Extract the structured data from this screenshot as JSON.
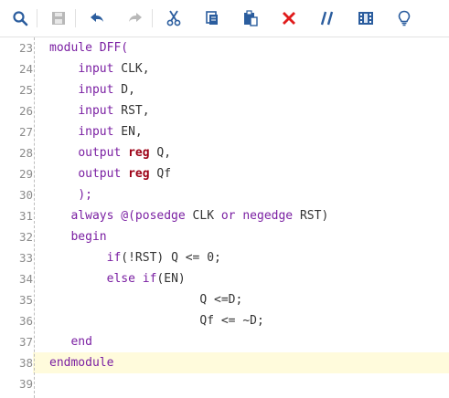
{
  "toolbar": {
    "buttons": [
      {
        "name": "search-icon",
        "enabled": true
      },
      {
        "name": "save-icon",
        "enabled": false
      },
      {
        "name": "undo-icon",
        "enabled": true
      },
      {
        "name": "redo-icon",
        "enabled": false
      },
      {
        "name": "cut-icon",
        "enabled": true
      },
      {
        "name": "copy-icon",
        "enabled": true
      },
      {
        "name": "paste-icon",
        "enabled": true
      },
      {
        "name": "delete-icon",
        "enabled": true
      },
      {
        "name": "comment-toggle-icon",
        "enabled": true
      },
      {
        "name": "template-icon",
        "enabled": true
      },
      {
        "name": "lightbulb-icon",
        "enabled": true
      }
    ],
    "colors": {
      "icon": "#2b5d9e",
      "disabled": "#b8b8b8",
      "delete": "#e01b1b"
    }
  },
  "editor": {
    "active_line": 38,
    "lines": [
      {
        "num": "23",
        "indent": "",
        "parts": [
          {
            "t": "module DFF(",
            "c": "kw"
          }
        ]
      },
      {
        "num": "24",
        "indent": "    ",
        "parts": [
          {
            "t": "input",
            "c": "kw"
          },
          {
            "t": " CLK,",
            "c": ""
          }
        ]
      },
      {
        "num": "25",
        "indent": "    ",
        "parts": [
          {
            "t": "input",
            "c": "kw"
          },
          {
            "t": " D,",
            "c": ""
          }
        ]
      },
      {
        "num": "26",
        "indent": "    ",
        "parts": [
          {
            "t": "input",
            "c": "kw"
          },
          {
            "t": " RST,",
            "c": ""
          }
        ]
      },
      {
        "num": "27",
        "indent": "    ",
        "parts": [
          {
            "t": "input",
            "c": "kw"
          },
          {
            "t": " EN,",
            "c": ""
          }
        ]
      },
      {
        "num": "28",
        "indent": "    ",
        "parts": [
          {
            "t": "output ",
            "c": "kw"
          },
          {
            "t": "reg",
            "c": "bold"
          },
          {
            "t": " Q,",
            "c": ""
          }
        ]
      },
      {
        "num": "29",
        "indent": "    ",
        "parts": [
          {
            "t": "output ",
            "c": "kw"
          },
          {
            "t": "reg",
            "c": "bold"
          },
          {
            "t": " Qf",
            "c": ""
          }
        ]
      },
      {
        "num": "30",
        "indent": "    ",
        "parts": [
          {
            "t": ");",
            "c": "kw"
          }
        ]
      },
      {
        "num": "31",
        "indent": "   ",
        "parts": [
          {
            "t": "always @(posedge",
            "c": "kw"
          },
          {
            "t": " CLK ",
            "c": ""
          },
          {
            "t": "or negedge",
            "c": "kw"
          },
          {
            "t": " RST)",
            "c": ""
          }
        ]
      },
      {
        "num": "32",
        "indent": "   ",
        "parts": [
          {
            "t": "begin",
            "c": "kw"
          }
        ]
      },
      {
        "num": "33",
        "indent": "        ",
        "parts": [
          {
            "t": "if",
            "c": "kw"
          },
          {
            "t": "(!RST) Q <= 0;",
            "c": ""
          }
        ]
      },
      {
        "num": "34",
        "indent": "        ",
        "parts": [
          {
            "t": "else if",
            "c": "kw"
          },
          {
            "t": "(EN)",
            "c": ""
          }
        ]
      },
      {
        "num": "35",
        "indent": "                     ",
        "parts": [
          {
            "t": "Q <=D;",
            "c": ""
          }
        ]
      },
      {
        "num": "36",
        "indent": "                     ",
        "parts": [
          {
            "t": "Qf <= ~D;",
            "c": ""
          }
        ]
      },
      {
        "num": "37",
        "indent": "   ",
        "parts": [
          {
            "t": "end",
            "c": "kw"
          }
        ]
      },
      {
        "num": "38",
        "indent": "",
        "parts": [
          {
            "t": "endmodule",
            "c": "kw"
          }
        ]
      },
      {
        "num": "39",
        "indent": "",
        "parts": []
      }
    ]
  }
}
